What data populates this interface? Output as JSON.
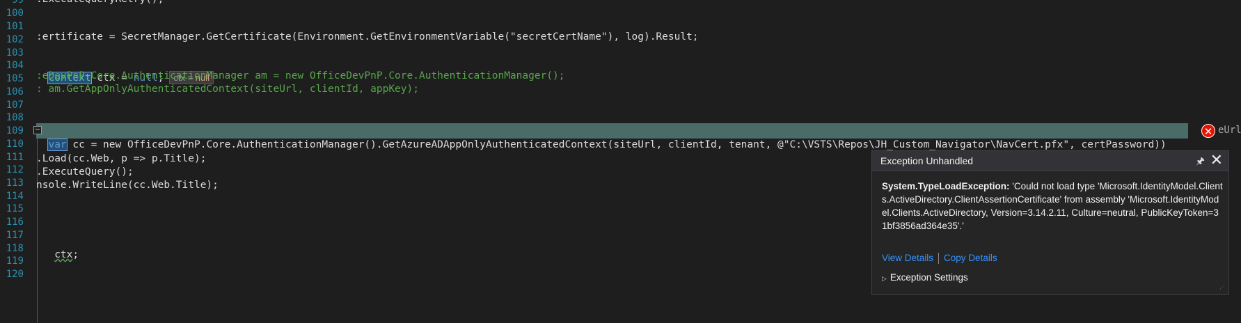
{
  "editor": {
    "lines": [
      {
        "num": "99"
      },
      {
        "num": "100"
      },
      {
        "num": "101"
      },
      {
        "num": "102"
      },
      {
        "num": "103"
      },
      {
        "num": "104"
      },
      {
        "num": "105"
      },
      {
        "num": "106"
      },
      {
        "num": "107"
      },
      {
        "num": "108"
      },
      {
        "num": "109"
      },
      {
        "num": "110"
      },
      {
        "num": "111"
      },
      {
        "num": "112"
      },
      {
        "num": "113"
      },
      {
        "num": "114"
      },
      {
        "num": "115"
      },
      {
        "num": "116"
      },
      {
        "num": "117"
      },
      {
        "num": "118"
      },
      {
        "num": "119"
      },
      {
        "num": "120"
      }
    ],
    "code": {
      "l99": ".ExecuteQueryRetry();",
      "l102": ":ertificate = SecretManager.GetCertificate(Environment.GetEnvironmentVariable(\"secretCertName\"), log).Result;",
      "l104_type": "Context",
      "l104_rest": " ctx = ",
      "l104_null": "null",
      "l104_end": ";",
      "l104_tip_name": "ctx",
      "l104_tip_eq": " = ",
      "l104_tip_val": "null",
      "l105": ":eDevPnP.Core.AuthenticationManager am = new OfficeDevPnP.Core.AuthenticationManager();",
      "l106": ": am.GetAppOnlyAuthenticatedContext(siteUrl, clientId, appKey);",
      "l108_kw": "var",
      "l108_rest": " cc = new OfficeDevPnP.Core.AuthenticationManager().GetAzureADAppOnlyAuthenticatedContext(siteUrl, clientId, tenant, @\"C:\\VSTS\\Repos\\JH_Custom_Navigator\\NavCert.pfx\", certPassword))",
      "l108_trail": "eUrl =",
      "l110": ".Load(cc.Web, p => p.Title);",
      "l111": ".ExecuteQuery();",
      "l112": "nsole.WriteLine(cc.Web.Title);",
      "l116_ctx": "ctx",
      "l116_end": ";"
    }
  },
  "exception_popup": {
    "title": "Exception Unhandled",
    "pin_icon": "pin-icon",
    "close_icon": "close-icon",
    "exception_type": "System.TypeLoadException:",
    "message": " 'Could not load type 'Microsoft.IdentityModel.Clients.ActiveDirectory.ClientAssertionCertificate' from assembly 'Microsoft.IdentityModel.Clients.ActiveDirectory, Version=3.14.2.11, Culture=neutral, PublicKeyToken=31bf3856ad364e35'.'",
    "view_details": "View Details",
    "copy_details": "Copy Details",
    "settings": "Exception Settings"
  },
  "colors": {
    "background": "#1e1e1e",
    "line_numbers": "#2b91af",
    "current_line_highlight": "#4a6c69",
    "error": "#e51400",
    "link": "#3794ff"
  }
}
